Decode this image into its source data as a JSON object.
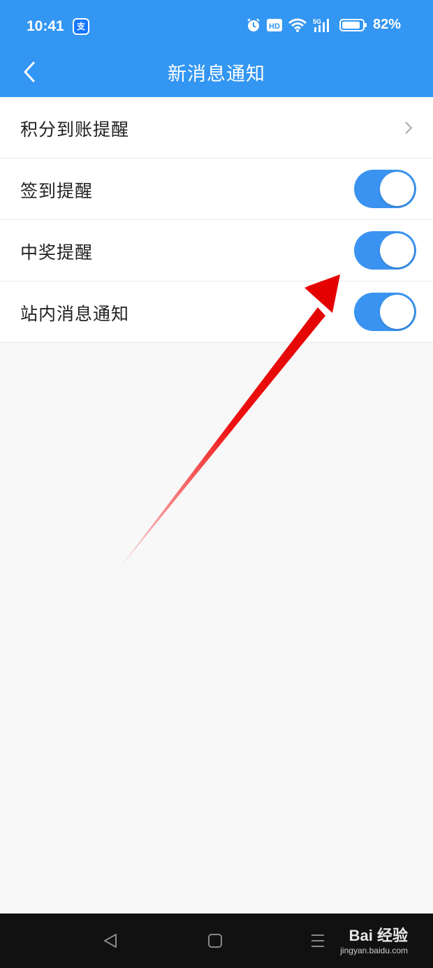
{
  "status_bar": {
    "time": "10:41",
    "app_icon": "alipay-icon",
    "icons": [
      "alarm-icon",
      "hd-icon",
      "wifi-icon",
      "5g-signal-icon",
      "battery-icon"
    ],
    "battery_percent": "82%"
  },
  "header": {
    "title": "新消息通知",
    "back_icon": "back-chevron-icon",
    "background_color": "#3396f2"
  },
  "settings": {
    "items": [
      {
        "label": "积分到账提醒",
        "type": "link"
      },
      {
        "label": "签到提醒",
        "type": "toggle",
        "on": true
      },
      {
        "label": "中奖提醒",
        "type": "toggle",
        "on": true
      },
      {
        "label": "站内消息通知",
        "type": "toggle",
        "on": true
      }
    ],
    "toggle_color": "#3a93f0"
  },
  "annotation": {
    "type": "arrow",
    "color": "#ee1111"
  },
  "system_nav": {
    "buttons": [
      "back-triangle-icon",
      "home-square-icon",
      "recents-menu-icon"
    ],
    "watermark_brand": "Bai 经验",
    "watermark_url": "jingyan.baidu.com"
  }
}
